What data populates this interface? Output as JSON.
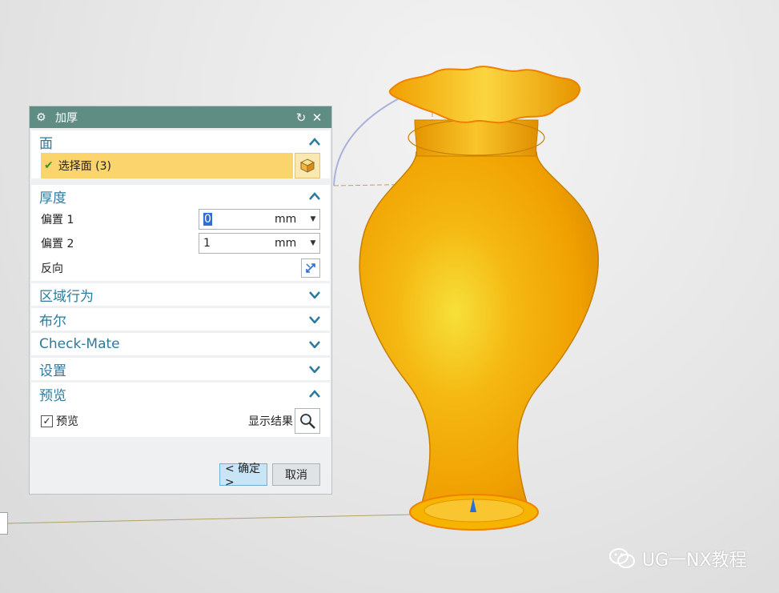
{
  "dialog": {
    "title": "加厚",
    "sections": {
      "face": {
        "label": "面",
        "select_text": "选择面 (3)"
      },
      "thickness": {
        "label": "厚度",
        "offset1": {
          "label": "偏置 1",
          "value": "0",
          "unit": "mm"
        },
        "offset2": {
          "label": "偏置 2",
          "value": "1",
          "unit": "mm"
        },
        "reverse_label": "反向"
      },
      "region": {
        "label": "区域行为"
      },
      "boolean": {
        "label": "布尔"
      },
      "checkmate": {
        "label": "Check-Mate"
      },
      "settings": {
        "label": "设置"
      },
      "preview": {
        "label": "预览",
        "checkbox_label": "预览",
        "show_result_label": "显示结果"
      }
    },
    "buttons": {
      "ok": "< 确定 >",
      "cancel": "取消"
    }
  },
  "watermark": {
    "text": "UG一NX教程"
  },
  "colors": {
    "accent": "#2b7ba0",
    "titlebar": "#5f8c83",
    "selection": "#fbd46e",
    "vase": "#f5a800"
  },
  "icons": [
    "gear-icon",
    "reset-icon",
    "close-icon",
    "check-icon",
    "cube-icon",
    "chevron-up-icon",
    "chevron-down-icon",
    "reverse-icon",
    "magnifier-icon",
    "wechat-icon"
  ]
}
